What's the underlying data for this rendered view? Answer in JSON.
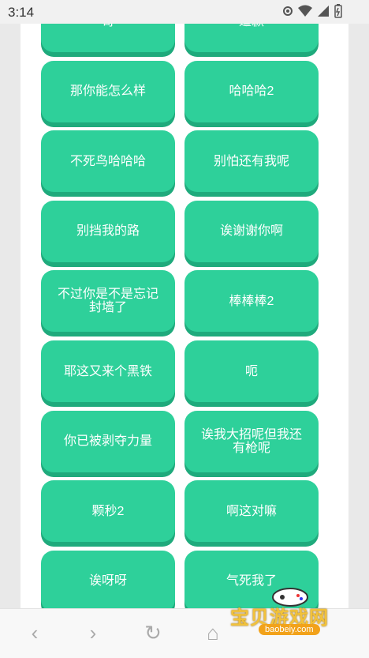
{
  "status": {
    "time": "3:14"
  },
  "buttons": [
    "哥",
    "道歉",
    "那你能怎么样",
    "哈哈哈2",
    "不死鸟哈哈哈",
    "别怕还有我呢",
    "别挡我的路",
    "诶谢谢你啊",
    "不过你是不是忘记封墙了",
    "棒棒棒2",
    "耶这又来个黑铁",
    "呃",
    "你已被剥夺力量",
    "诶我大招呢但我还有枪呢",
    "颗秒2",
    "啊这对嘛",
    "诶呀呀",
    "气死我了"
  ],
  "watermark": {
    "title": "宝贝游戏网",
    "sub": "baobeiy.com"
  },
  "colors": {
    "button": "#2ed09a",
    "button_shadow": "#1faa7c"
  }
}
